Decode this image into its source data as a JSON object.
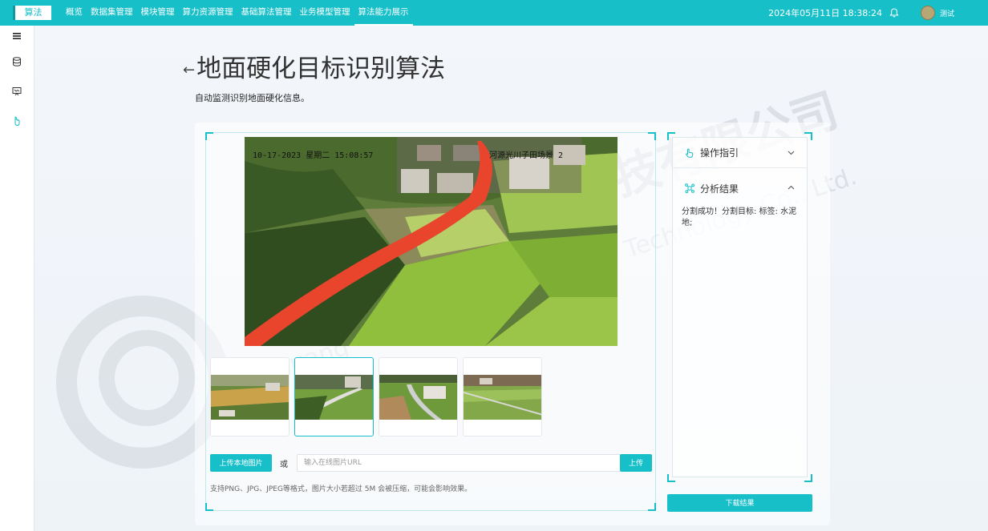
{
  "topbar": {
    "logo": "算法",
    "nav": [
      "概览",
      "数据集管理",
      "模块管理",
      "算力资源管理",
      "基础算法管理",
      "业务模型管理",
      "算法能力展示"
    ],
    "active_nav": 6,
    "datetime": "2024年05月11日 18:38:24",
    "username": "测试"
  },
  "sidebar": {
    "icons": [
      "menu-icon",
      "database-icon",
      "monitor-icon",
      "pointer-icon"
    ]
  },
  "page": {
    "back_arrow": "←",
    "title": "地面硬化目标识别算法",
    "description": "自动监测识别地面硬化信息。"
  },
  "image_overlay": {
    "left": "10-17-2023 星期二 15:08:57",
    "right": "河源光川子田场景 2"
  },
  "thumbnails": [
    {
      "name": "thumbnail-1",
      "selected": false
    },
    {
      "name": "thumbnail-2",
      "selected": true
    },
    {
      "name": "thumbnail-3",
      "selected": false
    },
    {
      "name": "thumbnail-4",
      "selected": false
    }
  ],
  "upload": {
    "local_button": "上传本地图片",
    "or": "或",
    "url_placeholder": "输入在线图片URL",
    "upload_button": "上传",
    "hint": "支持PNG、JPG、JPEG等格式，图片大小若超过 5M 会被压缩，可能会影响效果。"
  },
  "right_panel": {
    "guide_title": "操作指引",
    "result_title": "分析结果",
    "result_text": "分割成功！分割目标: 标签: 水泥地;",
    "download_button": "下载结果"
  },
  "watermark": {
    "chars": "技有限公司",
    "latin": "Guang     Technology Co., Ltd."
  },
  "colors": {
    "primary": "#17bfc9",
    "road_overlay": "#e8452c"
  }
}
